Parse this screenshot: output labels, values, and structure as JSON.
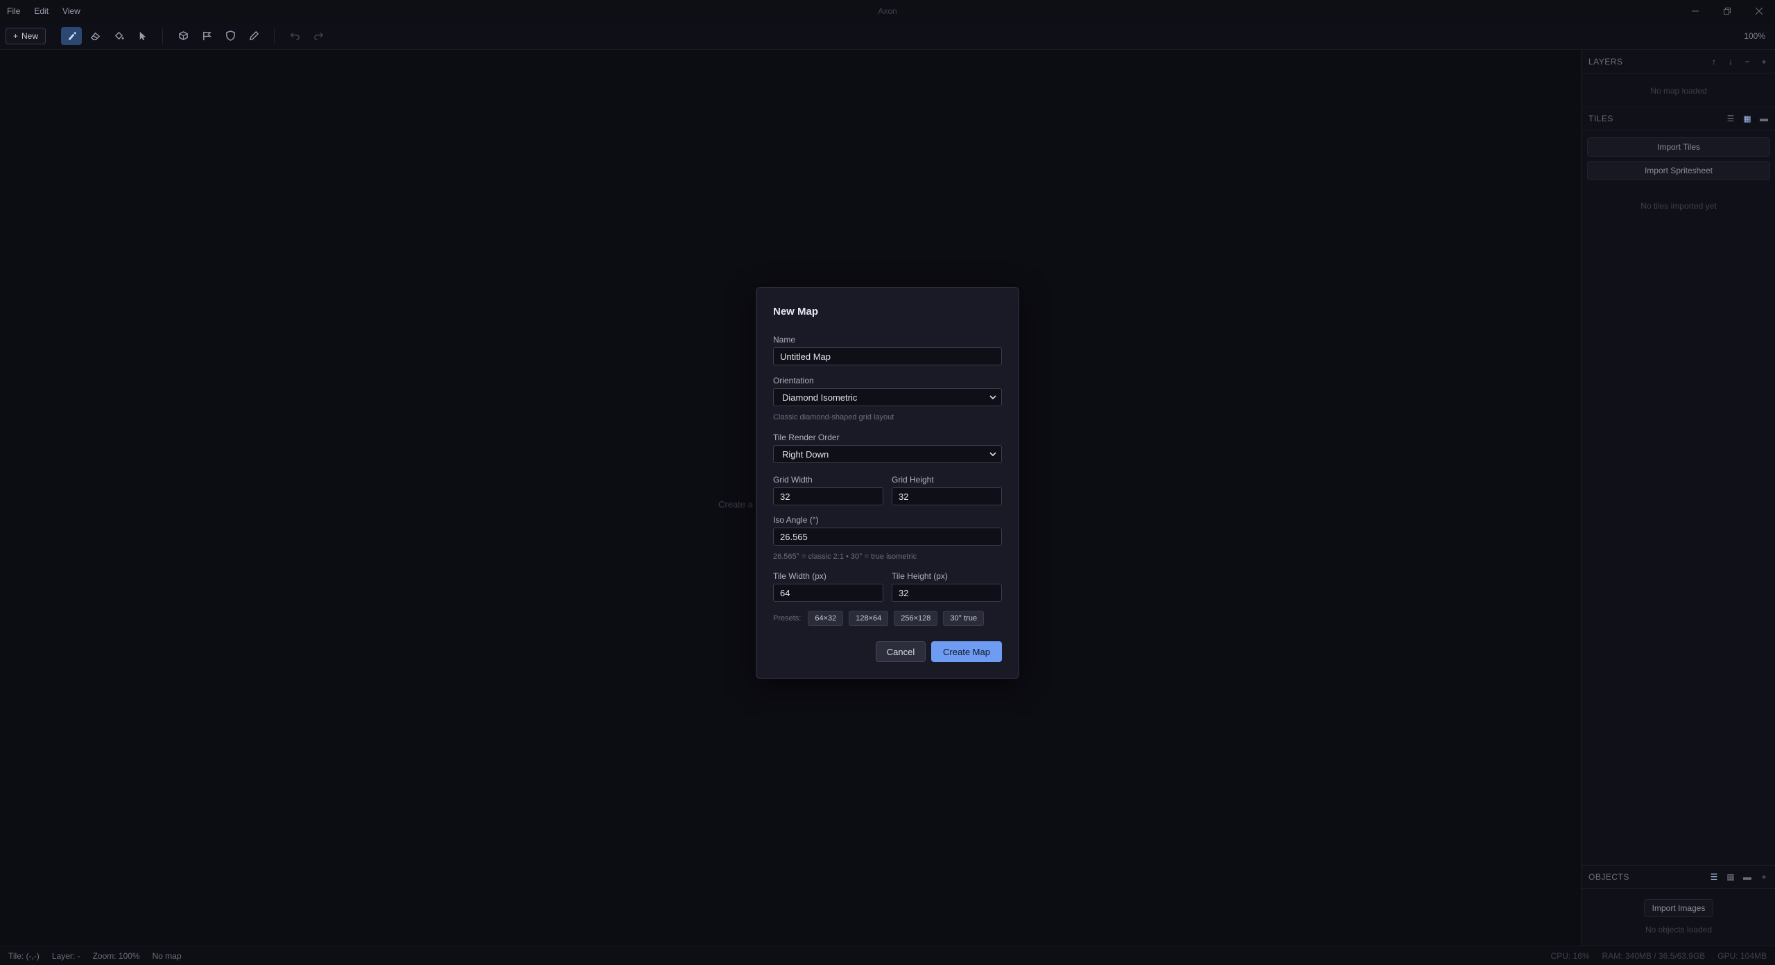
{
  "app": {
    "title": "Axon",
    "menu": [
      "File",
      "Edit",
      "View"
    ]
  },
  "toolbar": {
    "new_label": "New",
    "zoom": "100%"
  },
  "canvas": {
    "hint": "Create a"
  },
  "layers": {
    "title": "LAYERS",
    "empty": "No map loaded"
  },
  "tiles": {
    "title": "TILES",
    "import_tiles": "Import Tiles",
    "import_spritesheet": "Import Spritesheet",
    "empty": "No tiles imported yet"
  },
  "objects": {
    "title": "OBJECTS",
    "import_images": "Import Images",
    "empty": "No objects loaded"
  },
  "status": {
    "tile": "Tile: (-,-)",
    "layer": "Layer: -",
    "zoom": "Zoom: 100%",
    "map": "No map",
    "cpu": "CPU: 16%",
    "ram": "RAM: 340MB / 36.5/63.9GB",
    "gpu": "GPU: 104MB"
  },
  "dialog": {
    "title": "New Map",
    "name_label": "Name",
    "name_value": "Untitled Map",
    "orientation_label": "Orientation",
    "orientation_value": "Diamond Isometric",
    "orientation_hint": "Classic diamond-shaped grid layout",
    "render_order_label": "Tile Render Order",
    "render_order_value": "Right Down",
    "grid_width_label": "Grid Width",
    "grid_width_value": "32",
    "grid_height_label": "Grid Height",
    "grid_height_value": "32",
    "iso_angle_label": "Iso Angle (°)",
    "iso_angle_value": "26.565",
    "iso_angle_hint": "26.565° = classic 2:1 • 30° = true isometric",
    "tile_width_label": "Tile Width (px)",
    "tile_width_value": "64",
    "tile_height_label": "Tile Height (px)",
    "tile_height_value": "32",
    "presets_label": "Presets:",
    "presets": [
      "64×32",
      "128×64",
      "256×128",
      "30° true"
    ],
    "cancel_label": "Cancel",
    "create_label": "Create Map"
  },
  "colors": {
    "accent": "#6d9cf2",
    "active_tool": "#2d4773",
    "background": "#0c0c13"
  }
}
